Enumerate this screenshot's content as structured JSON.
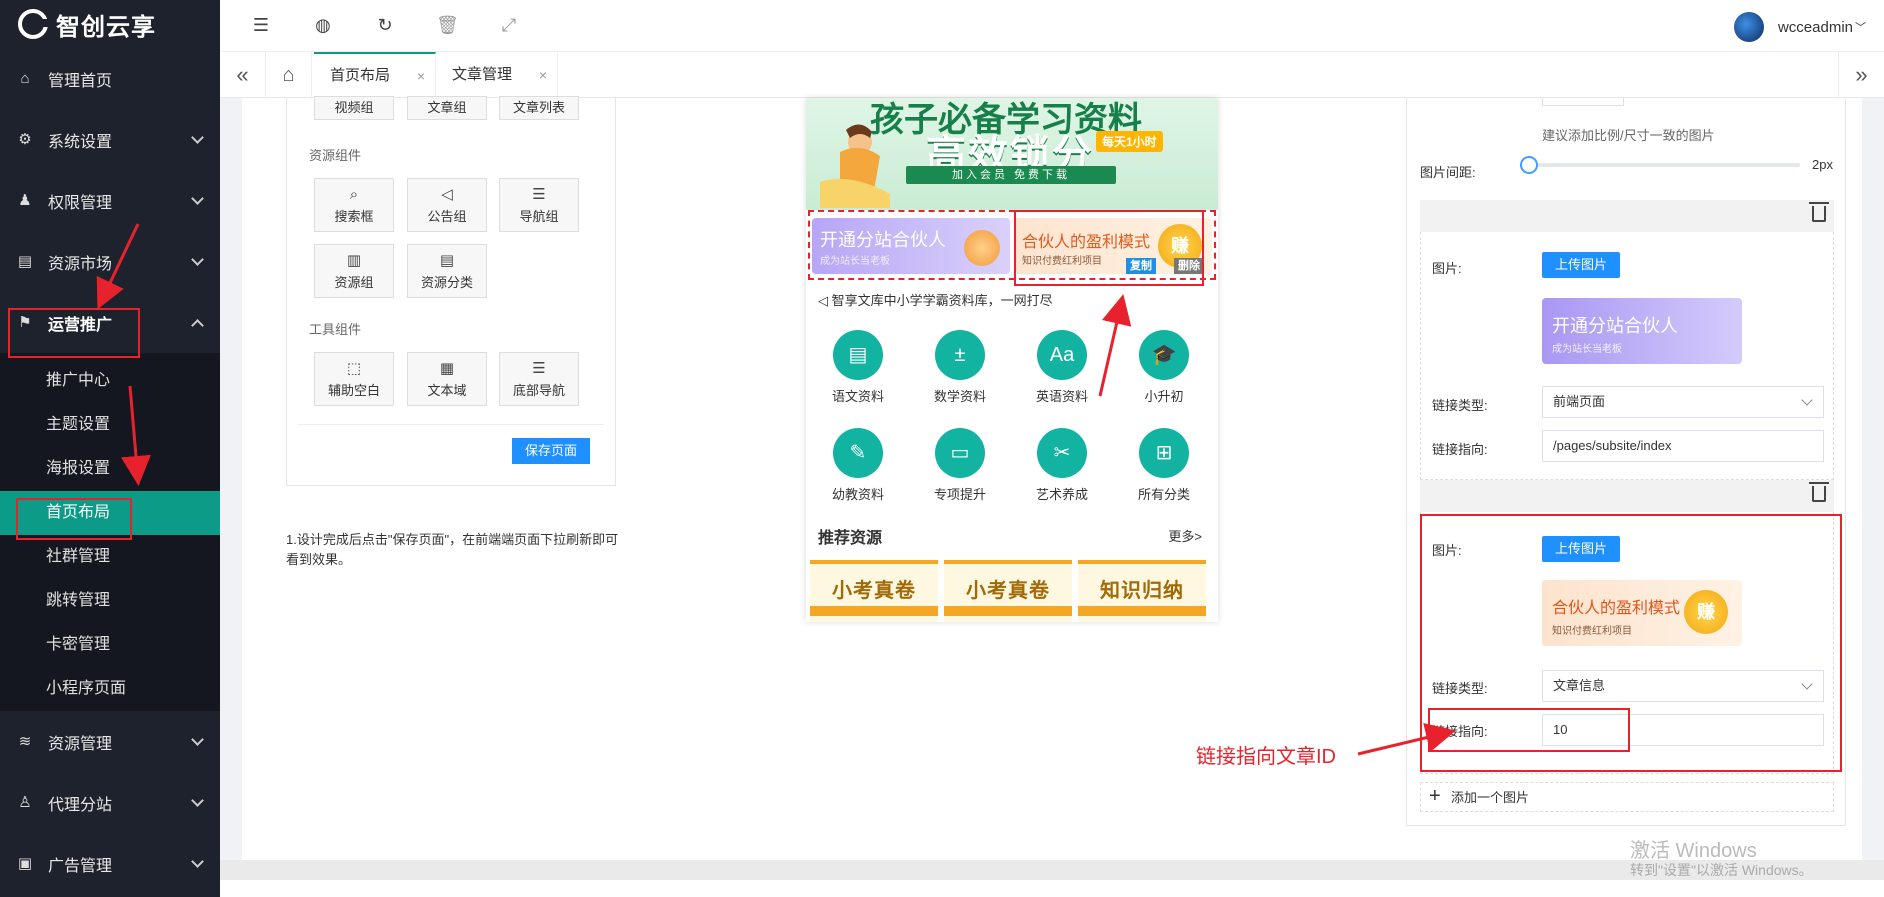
{
  "app": {
    "logo_text": "智创云享"
  },
  "sidebar": {
    "items": [
      {
        "label": "管理首页",
        "icon": "home-icon"
      },
      {
        "label": "系统设置",
        "icon": "gear-icon"
      },
      {
        "label": "权限管理",
        "icon": "user-key-icon"
      },
      {
        "label": "资源市场",
        "icon": "store-icon"
      },
      {
        "label": "运营推广",
        "icon": "flag-icon"
      },
      {
        "label": "资源管理",
        "icon": "layers-icon"
      },
      {
        "label": "代理分站",
        "icon": "agent-icon"
      },
      {
        "label": "广告管理",
        "icon": "ad-icon"
      }
    ],
    "submenu": [
      "推广中心",
      "主题设置",
      "海报设置",
      "首页布局",
      "社群管理",
      "跳转管理",
      "卡密管理",
      "小程序页面"
    ]
  },
  "topbar": {
    "username": "wcceadmin"
  },
  "tabs": [
    {
      "label": "首页布局"
    },
    {
      "label": "文章管理"
    }
  ],
  "components": {
    "row0": [
      "视频组",
      "文章组",
      "文章列表"
    ],
    "resource_title": "资源组件",
    "resource": [
      "搜索框",
      "公告组",
      "导航组",
      "资源组",
      "资源分类"
    ],
    "tool_title": "工具组件",
    "tool": [
      "辅助空白",
      "文本域",
      "底部导航"
    ],
    "save_label": "保存页面"
  },
  "tip": "1.设计完成后点击\"保存页面\"，在前端端页面下拉刷新即可看到效果。",
  "preview": {
    "hero_title": "孩子必备学习资料",
    "hero_sub": "高效锁分",
    "hero_badge": "每天1小时",
    "hero_strip": "加入会员  免费下载",
    "promo_a_title": "开通分站合伙人",
    "promo_a_sub": "成为站长当老板",
    "promo_b_title": "合伙人的盈利模式",
    "promo_b_sub": "知识付费红利项目",
    "promo_b_coin": "赚",
    "copy_label": "复制",
    "delete_label": "删除",
    "notice": "智享文库中小学学霸资料库，一网打尽",
    "grid": [
      "语文资料",
      "数学资料",
      "英语资料",
      "小升初",
      "幼教资料",
      "专项提升",
      "艺术养成",
      "所有分类"
    ],
    "rec_title": "推荐资源",
    "rec_more": "更多>",
    "rec_cards": [
      "小考真卷",
      "小考真卷",
      "知识归纳"
    ]
  },
  "settings": {
    "hint": "建议添加比例/尺寸一致的图片",
    "spacing_label": "图片间距:",
    "spacing_value": "2px",
    "spacing_fraction": 0,
    "image_label": "图片:",
    "upload_label": "上传图片",
    "link_type_label": "链接类型:",
    "link_target_label": "链接指向:",
    "item1": {
      "link_type": "前端页面",
      "link_target": "/pages/subsite/index"
    },
    "item2": {
      "link_type": "文章信息",
      "link_target": "10"
    },
    "add_label": "添加一个图片"
  },
  "annotation": {
    "callout": "链接指向文章ID"
  },
  "watermark": {
    "line1": "激活 Windows",
    "line2": "转到\"设置\"以激活 Windows。"
  },
  "colors": {
    "sidebar_bg": "#1e222d",
    "active_green": "#0b9b86",
    "primary_blue": "#1e90ff",
    "annotation_red": "#e8222c"
  }
}
